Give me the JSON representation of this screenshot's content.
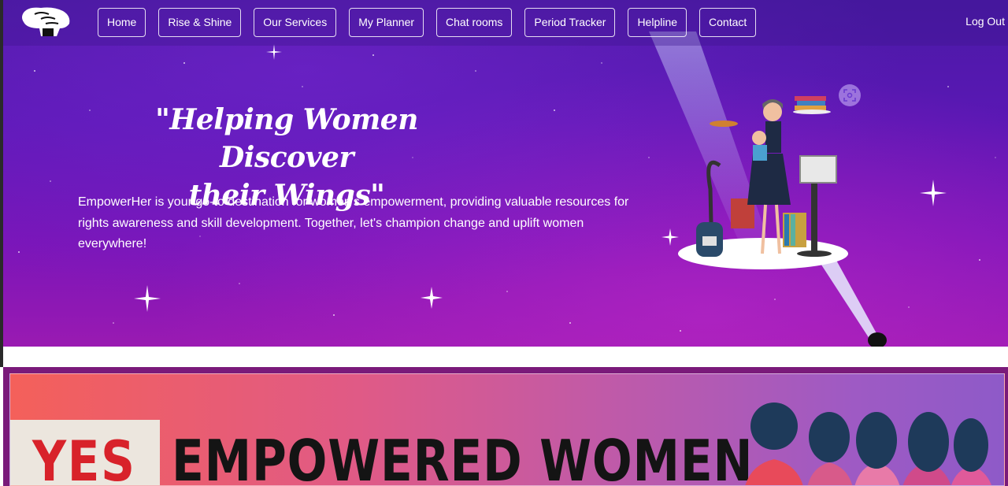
{
  "nav": {
    "logo": "logo-fist-icon",
    "links": [
      "Home",
      "Rise & Shine",
      "Our Services",
      "My Planner",
      "Chat rooms",
      "Period Tracker",
      "Helpline",
      "Contact"
    ],
    "logout": "Log Out"
  },
  "hero": {
    "tagline_line1": "\"Helping Women Discover",
    "tagline_line2": "their Wings\"",
    "description": "EmpowerHer is your go-to destination for women's empowerment, providing valuable resources for rights awareness and skill development. Together, let's champion change and uplift women everywhere!",
    "illustration": "multitasking-woman-illustration",
    "scan_icon": "image-scan-icon"
  },
  "banner": {
    "yes": "YES",
    "headline": "EMPOWERED WOMEN",
    "art": "group-of-women-illustration"
  },
  "colors": {
    "hero_top": "#4a1aa6",
    "hero_bottom": "#9a1ab2",
    "banner_frame": "#7a1a7a",
    "banner_left": "#f4605a",
    "banner_right": "#8e5ac8",
    "yes_red": "#d8222a"
  }
}
